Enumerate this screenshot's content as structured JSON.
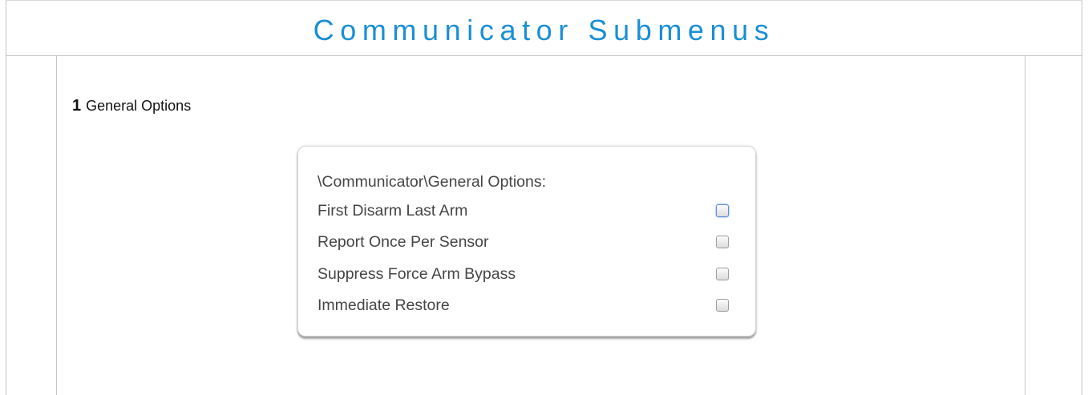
{
  "page": {
    "title": "Communicator Submenus"
  },
  "section": {
    "number": "1",
    "heading": "General Options"
  },
  "card": {
    "path": "\\Communicator\\General Options:",
    "options": [
      {
        "label": "First Disarm Last Arm",
        "checked": false,
        "focused": true
      },
      {
        "label": "Report Once Per Sensor",
        "checked": false,
        "focused": false
      },
      {
        "label": "Suppress Force Arm Bypass",
        "checked": false,
        "focused": false
      },
      {
        "label": "Immediate Restore",
        "checked": false,
        "focused": false
      }
    ]
  },
  "colors": {
    "title": "#1a8fd6",
    "text": "#454545",
    "border": "#c6c6c6",
    "focus": "#5b8dd6"
  }
}
